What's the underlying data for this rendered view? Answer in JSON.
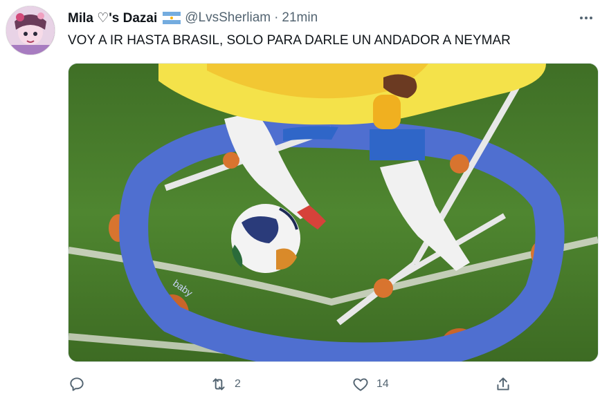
{
  "tweet": {
    "display_name": "Mila ♡'s Dazai",
    "handle": "@LvsSherliam",
    "separator": "·",
    "time": "21min",
    "text": "VOY A IR HASTA BRASIL, SOLO PARA DARLE UN ANDADOR A NEYMAR",
    "flag_icon": "argentina-flag-icon",
    "more_icon": "more-dots-icon",
    "media_icons": {
      "walker_logo_text": "baby"
    }
  },
  "actions": {
    "reply": {
      "icon": "reply-icon",
      "count": ""
    },
    "retweet": {
      "icon": "retweet-icon",
      "count": "2"
    },
    "like": {
      "icon": "heart-icon",
      "count": "14"
    },
    "share": {
      "icon": "share-icon",
      "count": ""
    }
  },
  "colors": {
    "text": "#0f1419",
    "muted": "#536471",
    "grass": "#4a7d2c",
    "walker_blue": "#4f6fd0",
    "walker_yellow": "#f4e24a",
    "flag_blue": "#74acdf"
  }
}
